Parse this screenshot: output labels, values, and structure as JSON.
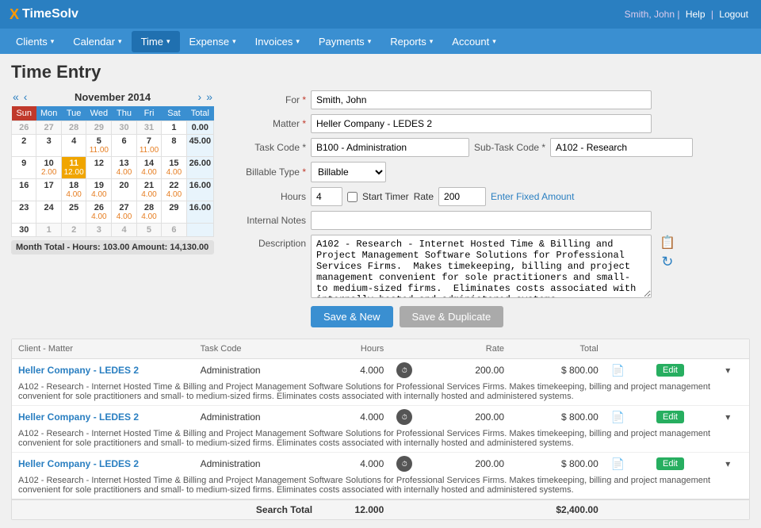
{
  "topbar": {
    "logo_x": "X",
    "logo_name": "TimeSolv",
    "user": "Smith, John",
    "sep1": "|",
    "help": "Help",
    "sep2": "|",
    "logout": "Logout"
  },
  "nav": {
    "items": [
      {
        "label": "Clients",
        "arrow": "▾",
        "active": false
      },
      {
        "label": "Calendar",
        "arrow": "▾",
        "active": false
      },
      {
        "label": "Time",
        "arrow": "▾",
        "active": true
      },
      {
        "label": "Expense",
        "arrow": "▾",
        "active": false
      },
      {
        "label": "Invoices",
        "arrow": "▾",
        "active": false
      },
      {
        "label": "Payments",
        "arrow": "▾",
        "active": false
      },
      {
        "label": "Reports",
        "arrow": "▾",
        "active": false
      },
      {
        "label": "Account",
        "arrow": "▾",
        "active": false
      }
    ]
  },
  "page_title": "Time Entry",
  "calendar": {
    "month": "November 2014",
    "headers": [
      "Sun",
      "Mon",
      "Tue",
      "Wed",
      "Thu",
      "Fri",
      "Sat",
      "Total"
    ],
    "weeks": [
      [
        {
          "day": "26",
          "hours": "",
          "other": true
        },
        {
          "day": "27",
          "hours": "",
          "other": true
        },
        {
          "day": "28",
          "hours": "",
          "other": true
        },
        {
          "day": "29",
          "hours": "",
          "other": true
        },
        {
          "day": "30",
          "hours": "",
          "other": true
        },
        {
          "day": "31",
          "hours": "",
          "other": true
        },
        {
          "day": "1",
          "hours": ""
        },
        {
          "total": "0.00"
        }
      ],
      [
        {
          "day": "2",
          "hours": ""
        },
        {
          "day": "3",
          "hours": ""
        },
        {
          "day": "4",
          "hours": ""
        },
        {
          "day": "5",
          "hours": "11.00",
          "color": "orange"
        },
        {
          "day": "6",
          "hours": ""
        },
        {
          "day": "7",
          "hours": "11.00",
          "color": "orange"
        },
        {
          "day": "8",
          "hours": ""
        },
        {
          "total": "45.00"
        }
      ],
      [
        {
          "day": "9",
          "hours": ""
        },
        {
          "day": "10",
          "hours": "2.00",
          "color": "orange"
        },
        {
          "day": "11",
          "hours": "12.00",
          "color": "selected"
        },
        {
          "day": "12",
          "hours": ""
        },
        {
          "day": "13",
          "hours": "4.00",
          "color": "orange"
        },
        {
          "day": "14",
          "hours": "4.00",
          "color": "orange"
        },
        {
          "day": "15",
          "hours": "4.00",
          "color": "orange"
        },
        {
          "total": "26.00"
        }
      ],
      [
        {
          "day": "16",
          "hours": ""
        },
        {
          "day": "17",
          "hours": ""
        },
        {
          "day": "18",
          "hours": "4.00",
          "color": "orange"
        },
        {
          "day": "19",
          "hours": "4.00",
          "color": "orange"
        },
        {
          "day": "20",
          "hours": ""
        },
        {
          "day": "21",
          "hours": "4.00",
          "color": "orange"
        },
        {
          "day": "22",
          "hours": "4.00",
          "color": "orange"
        },
        {
          "total": "16.00"
        }
      ],
      [
        {
          "day": "23",
          "hours": ""
        },
        {
          "day": "24",
          "hours": ""
        },
        {
          "day": "25",
          "hours": ""
        },
        {
          "day": "26",
          "hours": "4.00",
          "color": "orange"
        },
        {
          "day": "27",
          "hours": "4.00",
          "color": "orange"
        },
        {
          "day": "28",
          "hours": "4.00",
          "color": "orange"
        },
        {
          "day": "29",
          "hours": ""
        },
        {
          "total": "16.00"
        }
      ],
      [
        {
          "day": "30",
          "hours": ""
        },
        {
          "day": "1",
          "hours": "",
          "other": true
        },
        {
          "day": "2",
          "hours": "",
          "other": true
        },
        {
          "day": "3",
          "hours": "",
          "other": true
        },
        {
          "day": "4",
          "hours": "",
          "other": true
        },
        {
          "day": "5",
          "hours": "",
          "other": true
        },
        {
          "day": "6",
          "hours": "",
          "other": true
        },
        {
          "total": ""
        }
      ]
    ],
    "month_total": "Month Total - Hours: 103.00  Amount: 14,130.00"
  },
  "form": {
    "for_label": "For",
    "for_value": "Smith, John",
    "matter_label": "Matter",
    "matter_value": "Heller Company - LEDES 2",
    "task_code_label": "Task Code *",
    "task_code_value": "B100 - Administration",
    "sub_task_code_label": "Sub-Task Code *",
    "sub_task_code_value": "A102 - Research",
    "billable_type_label": "Billable Type",
    "billable_type_value": "Billable",
    "hours_label": "Hours",
    "hours_value": "4",
    "start_timer_label": "Start Timer",
    "rate_label": "Rate",
    "rate_value": "200",
    "enter_fixed_label": "Enter Fixed Amount",
    "internal_notes_label": "Internal Notes",
    "internal_notes_value": "",
    "description_label": "Description",
    "description_value": "A102 - Research - Internet Hosted Time & Billing and Project Management Software Solutions for Professional Services Firms.  Makes timekeeping, billing and project management convenient for sole practitioners and small- to medium-sized firms.  Eliminates costs associated with internally hosted and administered systems.",
    "save_new_label": "Save & New",
    "save_dup_label": "Save & Duplicate"
  },
  "table": {
    "headers": [
      "Client - Matter",
      "Task Code",
      "Hours",
      "",
      "Rate",
      "Total",
      "",
      "",
      ""
    ],
    "rows": [
      {
        "client": "Heller Company - LEDES 2",
        "task_code": "Administration",
        "hours": "4.000",
        "rate": "200.00",
        "total": "$ 800.00",
        "desc": "A102 - Research - Internet Hosted Time & Billing and Project Management Software Solutions for Professional Services Firms.  Makes timekeeping, billing and project management convenient for sole practitioners and small- to medium-sized firms.  Eliminates costs associated with internally hosted and administered systems."
      },
      {
        "client": "Heller Company - LEDES 2",
        "task_code": "Administration",
        "hours": "4.000",
        "rate": "200.00",
        "total": "$ 800.00",
        "desc": "A102 - Research - Internet Hosted Time & Billing and Project Management Software Solutions for Professional Services Firms.  Makes timekeeping, billing and project management convenient for sole practitioners and small- to medium-sized firms.  Eliminates costs associated with internally hosted and administered systems."
      },
      {
        "client": "Heller Company - LEDES 2",
        "task_code": "Administration",
        "hours": "4.000",
        "rate": "200.00",
        "total": "$ 800.00",
        "desc": "A102 - Research - Internet Hosted Time & Billing and Project Management Software Solutions for Professional Services Firms.  Makes timekeeping, billing and project management convenient for sole practitioners and small- to medium-sized firms.  Eliminates costs associated with internally hosted and administered systems."
      }
    ],
    "search_total_label": "Search Total",
    "search_total_hours": "12.000",
    "search_total_amount": "$2,400.00"
  }
}
